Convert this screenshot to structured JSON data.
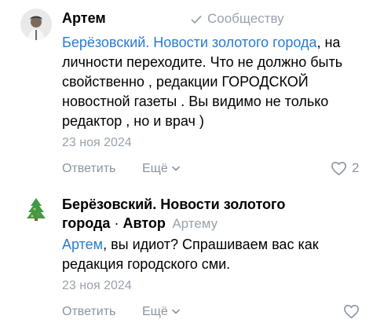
{
  "comments": [
    {
      "author": "Артем",
      "reply_to": "Сообществу",
      "text_link": "Берёзовский. Новости золотого города",
      "text_rest": ", на личности переходите. Что не должно быть свойственно , редакции ГОРОДСКОЙ новостной газеты . Вы видимо не только редактор , но и врач )",
      "date": "23 ноя 2024",
      "reply_label": "Ответить",
      "more_label": "Ещё",
      "likes": "2"
    },
    {
      "author_line1": "Берёзовский. Новости золотого",
      "author_line2": "города",
      "author_sep": " · ",
      "author_badge": "Автор",
      "reply_to": "Артему",
      "text_link": "Артем",
      "text_rest": ", вы идиот? Спрашиваем вас как редакция городского сми.",
      "date": "23 ноя 2024",
      "reply_label": "Ответить",
      "more_label": "Ещё"
    }
  ]
}
